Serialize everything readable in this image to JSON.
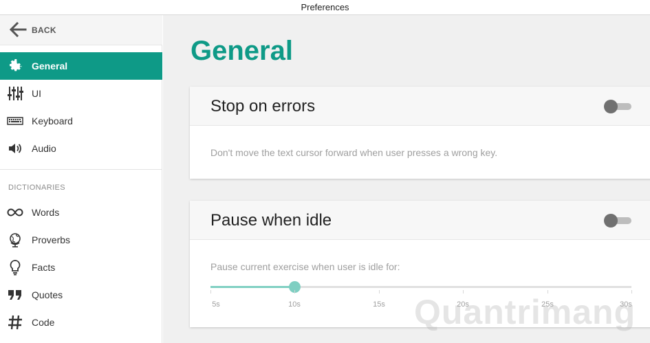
{
  "window": {
    "title": "Preferences"
  },
  "sidebar": {
    "back_label": "BACK",
    "items": [
      {
        "label": "General",
        "icon": "gear-icon",
        "active": true
      },
      {
        "label": "UI",
        "icon": "sliders-icon",
        "active": false
      },
      {
        "label": "Keyboard",
        "icon": "keyboard-icon",
        "active": false
      },
      {
        "label": "Audio",
        "icon": "speaker-icon",
        "active": false
      }
    ],
    "section_title": "DICTIONARIES",
    "dictionaries": [
      {
        "label": "Words",
        "icon": "infinity-icon"
      },
      {
        "label": "Proverbs",
        "icon": "globe-icon"
      },
      {
        "label": "Facts",
        "icon": "lightbulb-icon"
      },
      {
        "label": "Quotes",
        "icon": "quote-icon"
      },
      {
        "label": "Code",
        "icon": "hash-icon"
      }
    ]
  },
  "main": {
    "title": "General",
    "cards": [
      {
        "title": "Stop on errors",
        "enabled": false,
        "description": "Don't move the text cursor forward when user presses a wrong key."
      },
      {
        "title": "Pause when idle",
        "enabled": false,
        "description": "Pause current exercise when user is idle for:",
        "slider": {
          "value": "10s",
          "ticks": [
            "5s",
            "10s",
            "15s",
            "20s",
            "25s",
            "30s"
          ]
        }
      }
    ]
  },
  "watermark": "Quantrimang",
  "colors": {
    "accent": "#0e9a87",
    "slider": "#7fcfc2",
    "background": "#f0f0f0"
  }
}
